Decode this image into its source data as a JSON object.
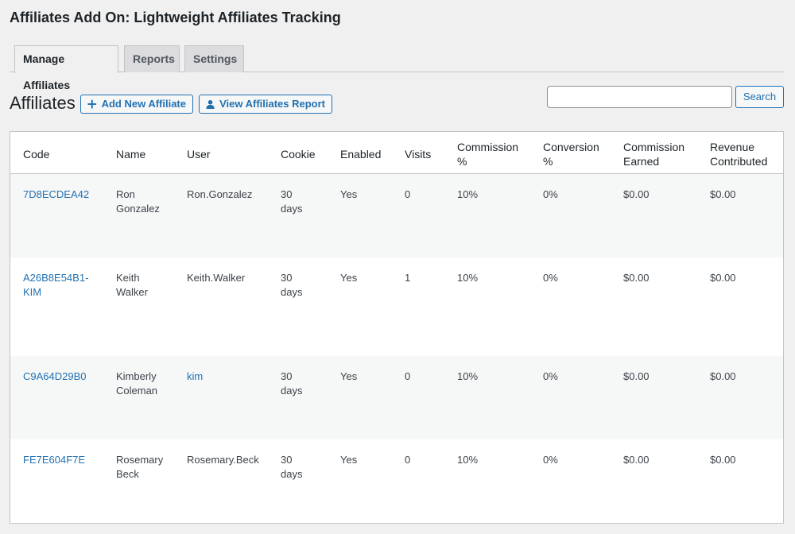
{
  "page": {
    "title": "Affiliates Add On: Lightweight Affiliates Tracking"
  },
  "tabs": [
    {
      "label": "Manage Affiliates",
      "active": true
    },
    {
      "label": "Reports",
      "active": false
    },
    {
      "label": "Settings",
      "active": false
    }
  ],
  "toolbar": {
    "heading": "Affiliates",
    "add_label": "Add New Affiliate",
    "report_label": "View Affiliates Report",
    "search_value": "",
    "search_button": "Search"
  },
  "table": {
    "columns": {
      "code": "Code",
      "name": "Name",
      "user": "User",
      "cookie": "Cookie",
      "enabled": "Enabled",
      "visits": "Visits",
      "commission_1": "Commission",
      "commission_2": "%",
      "conversion_1": "Conversion",
      "conversion_2": "%",
      "earned_1": "Commission",
      "earned_2": "Earned",
      "revenue_1": "Revenue",
      "revenue_2": "Contributed"
    },
    "rows": [
      {
        "code_1": "7D8ECDEA42",
        "code_2": "",
        "name_1": "Ron",
        "name_2": "Gonzalez",
        "user": "Ron.Gonzalez",
        "user_link": false,
        "cookie_1": "30",
        "cookie_2": "days",
        "enabled": "Yes",
        "visits": "0",
        "commission": "10%",
        "conversion": "0%",
        "earned": "$0.00",
        "revenue": "$0.00"
      },
      {
        "code_1": "A26B8E54B1-",
        "code_2": "KIM",
        "name_1": "Keith",
        "name_2": "Walker",
        "user": "Keith.Walker",
        "user_link": false,
        "cookie_1": "30",
        "cookie_2": "days",
        "enabled": "Yes",
        "visits": "1",
        "commission": "10%",
        "conversion": "0%",
        "earned": "$0.00",
        "revenue": "$0.00"
      },
      {
        "code_1": "C9A64D29B0",
        "code_2": "",
        "name_1": "Kimberly",
        "name_2": "Coleman",
        "user": "kim",
        "user_link": true,
        "cookie_1": "30",
        "cookie_2": "days",
        "enabled": "Yes",
        "visits": "0",
        "commission": "10%",
        "conversion": "0%",
        "earned": "$0.00",
        "revenue": "$0.00"
      },
      {
        "code_1": "FE7E604F7E",
        "code_2": "",
        "name_1": "Rosemary",
        "name_2": "Beck",
        "user": "Rosemary.Beck",
        "user_link": false,
        "cookie_1": "30",
        "cookie_2": "days",
        "enabled": "Yes",
        "visits": "0",
        "commission": "10%",
        "conversion": "0%",
        "earned": "$0.00",
        "revenue": "$0.00"
      }
    ]
  },
  "colors": {
    "link": "#2271b1",
    "background": "#f0f0f1",
    "row_alt": "#f6f7f7"
  },
  "icons": {
    "add": "plus-icon",
    "report": "user-icon"
  }
}
